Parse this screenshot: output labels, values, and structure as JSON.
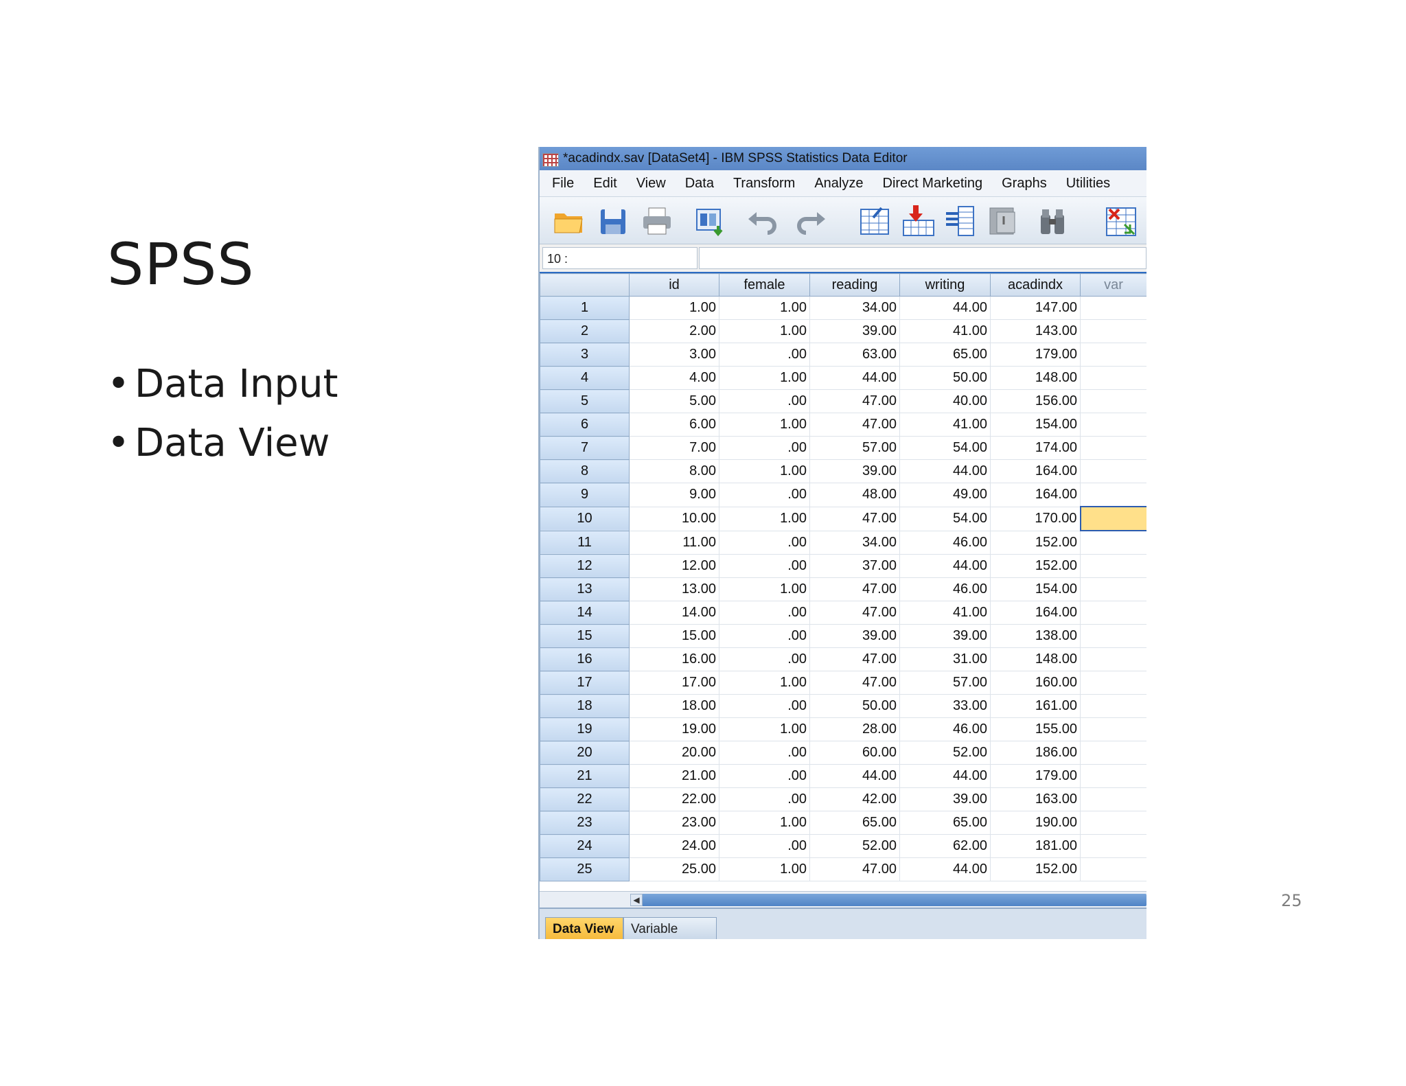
{
  "slide": {
    "title": "SPSS",
    "bullets": [
      "Data Input",
      "Data View"
    ],
    "bullet_char": "•",
    "page_number": "25"
  },
  "window": {
    "title": "*acadindx.sav [DataSet4] - IBM SPSS Statistics Data Editor"
  },
  "menu": [
    "File",
    "Edit",
    "View",
    "Data",
    "Transform",
    "Analyze",
    "Direct Marketing",
    "Graphs",
    "Utilities"
  ],
  "toolbar": {
    "icons": [
      "open-folder-icon",
      "save-icon",
      "print-icon",
      "recall-dialog-icon",
      "undo-icon",
      "redo-icon",
      "goto-case-icon",
      "goto-variable-icon",
      "variables-icon",
      "find-icon",
      "split-file-icon",
      "select-cases-icon"
    ]
  },
  "cell_editor": {
    "reference": "10 :",
    "value": ""
  },
  "grid": {
    "columns": [
      "id",
      "female",
      "reading",
      "writing",
      "acadindx",
      "var"
    ],
    "rows": [
      {
        "n": "1",
        "cells": [
          "1.00",
          "1.00",
          "34.00",
          "44.00",
          "147.00"
        ]
      },
      {
        "n": "2",
        "cells": [
          "2.00",
          "1.00",
          "39.00",
          "41.00",
          "143.00"
        ]
      },
      {
        "n": "3",
        "cells": [
          "3.00",
          ".00",
          "63.00",
          "65.00",
          "179.00"
        ]
      },
      {
        "n": "4",
        "cells": [
          "4.00",
          "1.00",
          "44.00",
          "50.00",
          "148.00"
        ]
      },
      {
        "n": "5",
        "cells": [
          "5.00",
          ".00",
          "47.00",
          "40.00",
          "156.00"
        ]
      },
      {
        "n": "6",
        "cells": [
          "6.00",
          "1.00",
          "47.00",
          "41.00",
          "154.00"
        ]
      },
      {
        "n": "7",
        "cells": [
          "7.00",
          ".00",
          "57.00",
          "54.00",
          "174.00"
        ]
      },
      {
        "n": "8",
        "cells": [
          "8.00",
          "1.00",
          "39.00",
          "44.00",
          "164.00"
        ]
      },
      {
        "n": "9",
        "cells": [
          "9.00",
          ".00",
          "48.00",
          "49.00",
          "164.00"
        ]
      },
      {
        "n": "10",
        "cells": [
          "10.00",
          "1.00",
          "47.00",
          "54.00",
          "170.00"
        ]
      },
      {
        "n": "11",
        "cells": [
          "11.00",
          ".00",
          "34.00",
          "46.00",
          "152.00"
        ]
      },
      {
        "n": "12",
        "cells": [
          "12.00",
          ".00",
          "37.00",
          "44.00",
          "152.00"
        ]
      },
      {
        "n": "13",
        "cells": [
          "13.00",
          "1.00",
          "47.00",
          "46.00",
          "154.00"
        ]
      },
      {
        "n": "14",
        "cells": [
          "14.00",
          ".00",
          "47.00",
          "41.00",
          "164.00"
        ]
      },
      {
        "n": "15",
        "cells": [
          "15.00",
          ".00",
          "39.00",
          "39.00",
          "138.00"
        ]
      },
      {
        "n": "16",
        "cells": [
          "16.00",
          ".00",
          "47.00",
          "31.00",
          "148.00"
        ]
      },
      {
        "n": "17",
        "cells": [
          "17.00",
          "1.00",
          "47.00",
          "57.00",
          "160.00"
        ]
      },
      {
        "n": "18",
        "cells": [
          "18.00",
          ".00",
          "50.00",
          "33.00",
          "161.00"
        ]
      },
      {
        "n": "19",
        "cells": [
          "19.00",
          "1.00",
          "28.00",
          "46.00",
          "155.00"
        ]
      },
      {
        "n": "20",
        "cells": [
          "20.00",
          ".00",
          "60.00",
          "52.00",
          "186.00"
        ]
      },
      {
        "n": "21",
        "cells": [
          "21.00",
          ".00",
          "44.00",
          "44.00",
          "179.00"
        ]
      },
      {
        "n": "22",
        "cells": [
          "22.00",
          ".00",
          "42.00",
          "39.00",
          "163.00"
        ]
      },
      {
        "n": "23",
        "cells": [
          "23.00",
          "1.00",
          "65.00",
          "65.00",
          "190.00"
        ]
      },
      {
        "n": "24",
        "cells": [
          "24.00",
          ".00",
          "52.00",
          "62.00",
          "181.00"
        ]
      },
      {
        "n": "25",
        "cells": [
          "25.00",
          "1.00",
          "47.00",
          "44.00",
          "152.00"
        ]
      }
    ],
    "selected_row": "10",
    "selected_column": "var"
  },
  "tabs": [
    "Data View",
    "Variable View"
  ],
  "active_tab": "Data View",
  "colors": {
    "titlebar": "#5b87c6",
    "selected_cell": "#ffe08a",
    "active_tab": "#f5b93a",
    "row_header": "#c4d8ef"
  }
}
